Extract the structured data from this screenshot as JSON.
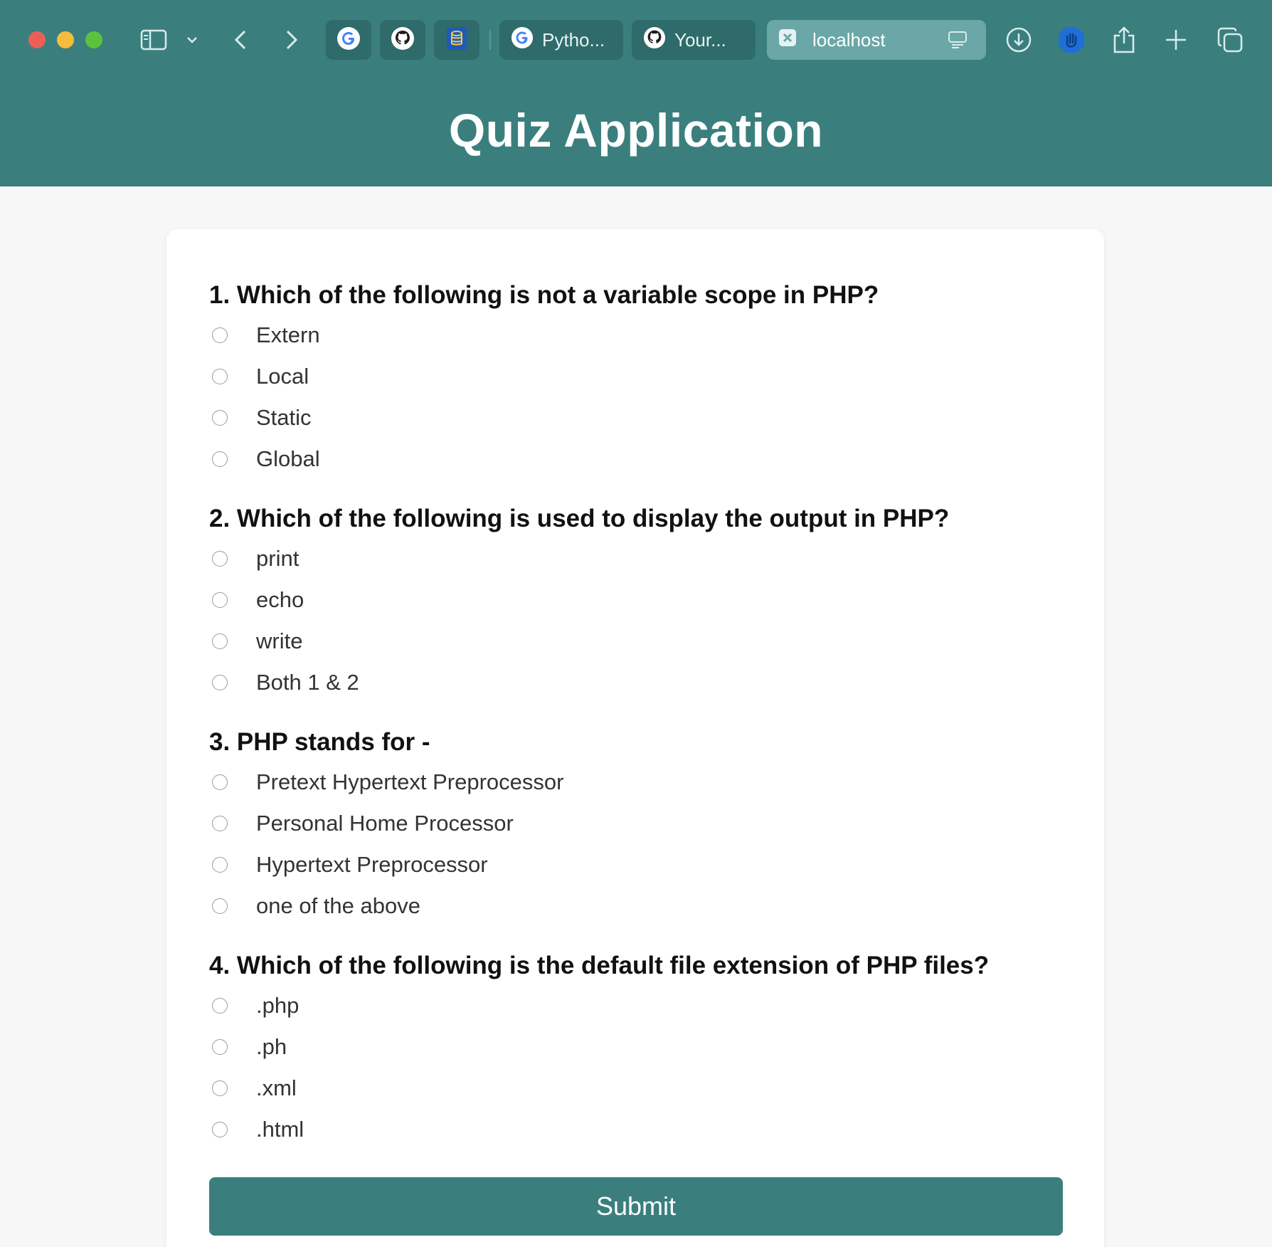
{
  "browser": {
    "tabs": [
      {
        "icon": "google-icon",
        "title": "Pytho..."
      },
      {
        "icon": "github-icon",
        "title": "Your..."
      },
      {
        "icon": "close-icon",
        "title": "localhost",
        "active": true
      }
    ],
    "pinned": [
      "google-icon",
      "github-icon",
      "database-icon"
    ]
  },
  "header": {
    "title": "Quiz Application",
    "background": "#3a7f7e"
  },
  "quiz": {
    "questions": [
      {
        "text": "1. Which of the following is not a variable scope in PHP?",
        "options": [
          "Extern",
          "Local",
          "Static",
          "Global"
        ]
      },
      {
        "text": "2. Which of the following is used to display the output in PHP?",
        "options": [
          "print",
          "echo",
          "write",
          "Both 1 & 2"
        ]
      },
      {
        "text": "3. PHP stands for -",
        "options": [
          "Pretext Hypertext Preprocessor",
          "Personal Home Processor",
          "Hypertext Preprocessor",
          "one of the above"
        ]
      },
      {
        "text": "4. Which of the following is the default file extension of PHP files?",
        "options": [
          ".php",
          ".ph",
          ".xml",
          ".html"
        ]
      }
    ],
    "submit_label": "Submit"
  }
}
